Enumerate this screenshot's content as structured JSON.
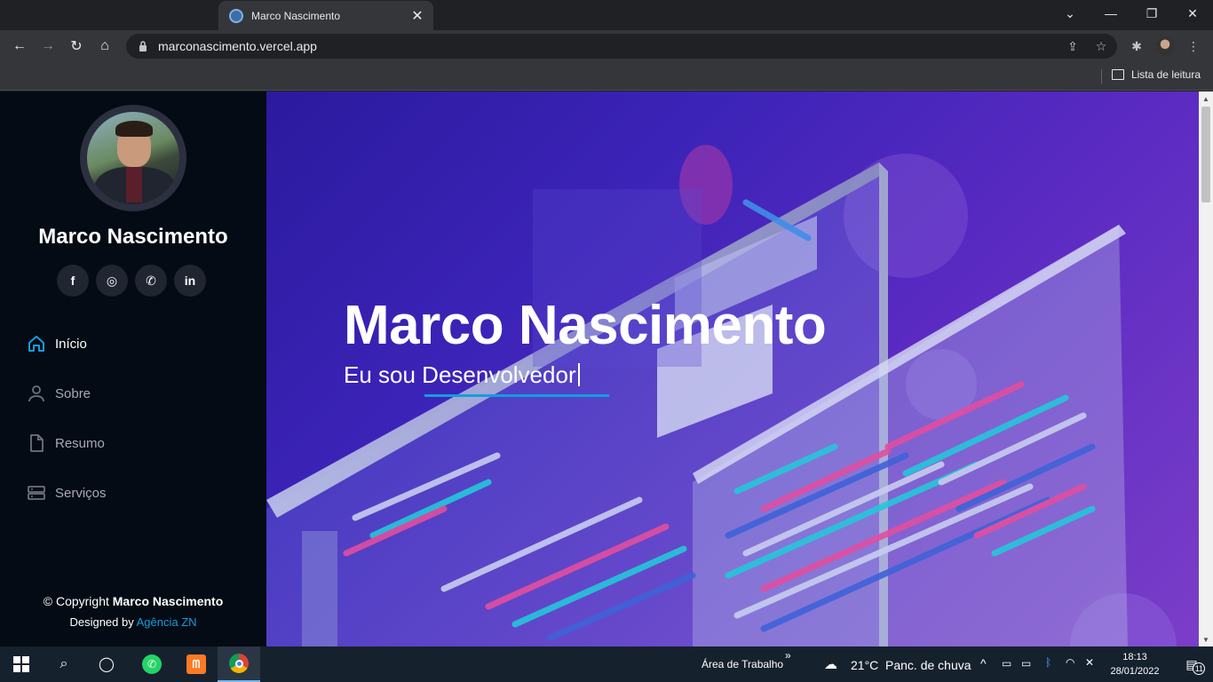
{
  "browser": {
    "tab_title": "Marco Nascimento",
    "url": "marconascimento.vercel.app",
    "reading_list_label": "Lista de leitura"
  },
  "sidebar": {
    "name": "Marco Nascimento",
    "social": [
      {
        "label": "f",
        "icon": "facebook-icon"
      },
      {
        "label": "◎",
        "icon": "instagram-icon"
      },
      {
        "label": "✆",
        "icon": "whatsapp-icon"
      },
      {
        "label": "in",
        "icon": "linkedin-icon"
      }
    ],
    "nav": [
      {
        "label": "Início",
        "icon": "home-icon",
        "active": true
      },
      {
        "label": "Sobre",
        "icon": "user-icon",
        "active": false
      },
      {
        "label": "Resumo",
        "icon": "file-icon",
        "active": false
      },
      {
        "label": "Serviços",
        "icon": "server-icon",
        "active": false
      }
    ],
    "footer": {
      "copyright_prefix": "© Copyright ",
      "copyright_name": "Marco Nascimento",
      "designed_by": "Designed by ",
      "agency": "Agência ZN"
    }
  },
  "hero": {
    "title": "Marco Nascimento",
    "subtitle": "Eu sou Desenvolvedor"
  },
  "taskbar": {
    "desktop_label": "Área de Trabalho",
    "weather_temp": "21°C",
    "weather_text": "Panc. de chuva",
    "time": "18:13",
    "date": "28/01/2022",
    "notifications": "11"
  },
  "colors": {
    "accent": "#149ddd",
    "sidebar_bg": "#040b14"
  }
}
